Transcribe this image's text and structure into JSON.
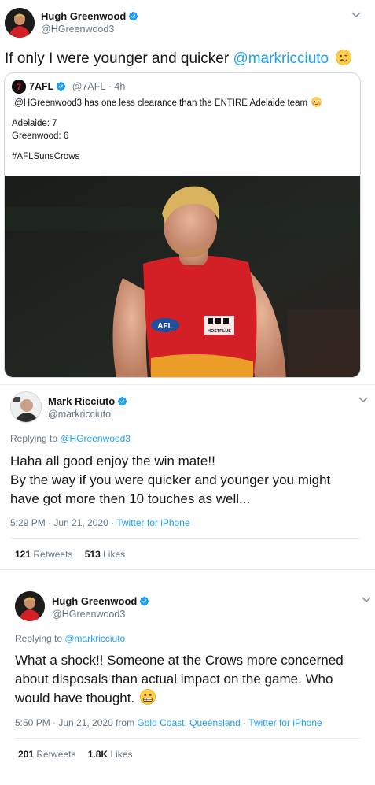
{
  "tweet1": {
    "author_name": "Hugh Greenwood",
    "author_handle": "@HGreenwood3",
    "text": "If only I were younger and quicker ",
    "mention": "@markricciuto",
    "quote": {
      "author_name": "7AFL",
      "author_handle": "@7AFL",
      "time": "· 4h",
      "line1": ".@HGreenwood3 has one less clearance than the ENTIRE Adelaide team",
      "line2": "Adelaide: 7",
      "line3": "Greenwood: 6",
      "hashtag": "#AFLSunsCrows",
      "photo_jersey_text": "AFL",
      "photo_sponsor_text": "HOSTPLUS"
    }
  },
  "tweet2": {
    "author_name": "Mark Ricciuto",
    "author_handle": "@markricciuto",
    "replying_prefix": "Replying to ",
    "replying_to": "@HGreenwood3",
    "line1": "Haha all good enjoy the win mate!!",
    "line2": "By the way if you were quicker and younger you might",
    "line3": "have got more then 10 touches as well...",
    "timestamp": "5:29 PM · Jun 21, 2020 · ",
    "source": "Twitter for iPhone",
    "retweets_count": "121",
    "retweets_label": "Retweets",
    "likes_count": "513",
    "likes_label": "Likes"
  },
  "tweet3": {
    "author_name": "Hugh Greenwood",
    "author_handle": "@HGreenwood3",
    "replying_prefix": "Replying to ",
    "replying_to": "@markricciuto",
    "line1": "What a shock!! Someone at the Crows more concerned",
    "line2": "about disposals than actual impact on the game. Who",
    "line3": "would have thought. ",
    "timestamp": "5:50 PM · Jun 21, 2020 from ",
    "location": "Gold Coast, Queensland",
    "source_sep": " · ",
    "source": "Twitter for iPhone",
    "retweets_count": "201",
    "retweets_label": "Retweets",
    "likes_count": "1.8K",
    "likes_label": "Likes"
  },
  "colors": {
    "link": "#1da1f2",
    "verified": "#1da1f2",
    "muted": "#657786",
    "jersey_red": "#d51f26"
  },
  "icons": [
    "verified-badge-icon",
    "chevron-down-icon",
    "woozy-face-emoji",
    "grimace-face-emoji"
  ]
}
